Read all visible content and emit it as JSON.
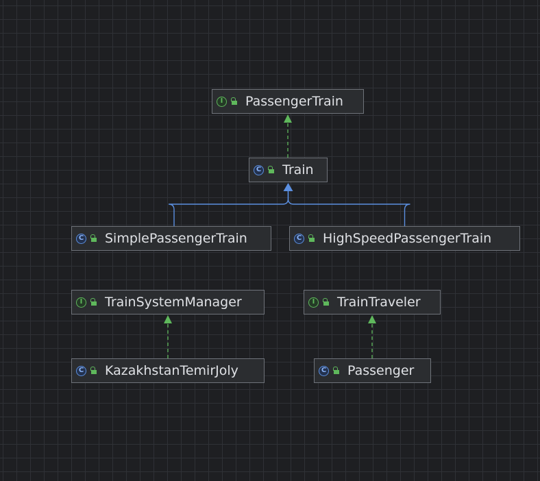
{
  "colors": {
    "background": "#1e1f22",
    "node_fill": "#2b2d30",
    "node_border": "#6f737a",
    "text": "#dfe1e5",
    "interface_icon": "#5fb85c",
    "class_icon": "#5b8fe0",
    "realization_edge": "#5fb85c",
    "generalization_edge": "#5b8fe0"
  },
  "nodes": [
    {
      "id": "passenger-train",
      "label": "PassengerTrain",
      "kind": "interface",
      "icon_letter": "I"
    },
    {
      "id": "train",
      "label": "Train",
      "kind": "class",
      "icon_letter": "C"
    },
    {
      "id": "simple-passenger-train",
      "label": "SimplePassengerTrain",
      "kind": "class",
      "icon_letter": "C"
    },
    {
      "id": "high-speed-passenger-train",
      "label": "HighSpeedPassengerTrain",
      "kind": "class",
      "icon_letter": "C"
    },
    {
      "id": "train-system-manager",
      "label": "TrainSystemManager",
      "kind": "interface",
      "icon_letter": "I"
    },
    {
      "id": "train-traveler",
      "label": "TrainTraveler",
      "kind": "interface",
      "icon_letter": "I"
    },
    {
      "id": "kazakhstan-temir-joly",
      "label": "KazakhstanTemirJoly",
      "kind": "class",
      "icon_letter": "C"
    },
    {
      "id": "passenger",
      "label": "Passenger",
      "kind": "class",
      "icon_letter": "C"
    }
  ],
  "edges": [
    {
      "from": "train",
      "to": "passenger-train",
      "type": "realization"
    },
    {
      "from": "simple-passenger-train",
      "to": "train",
      "type": "generalization"
    },
    {
      "from": "high-speed-passenger-train",
      "to": "train",
      "type": "generalization"
    },
    {
      "from": "kazakhstan-temir-joly",
      "to": "train-system-manager",
      "type": "realization"
    },
    {
      "from": "passenger",
      "to": "train-traveler",
      "type": "realization"
    }
  ]
}
